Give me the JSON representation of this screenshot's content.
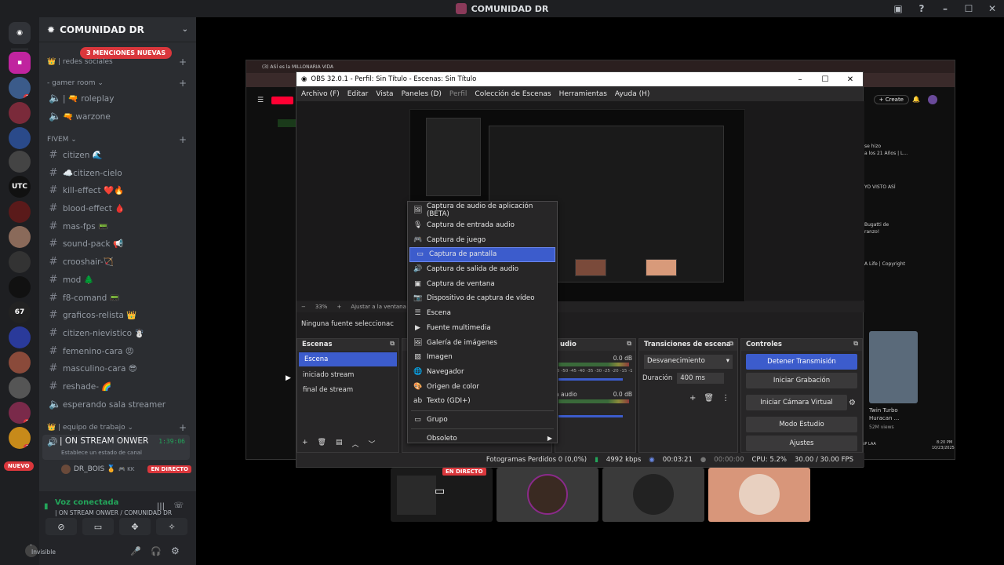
{
  "window": {
    "title": "COMUNIDAD DR"
  },
  "server": {
    "name": "COMUNIDAD DR",
    "mentions_badge": "3 MENCIONES NUEVAS",
    "new_badge": "NUEVO"
  },
  "rail": {
    "badges": [
      "3",
      "3",
      "2",
      "3"
    ],
    "labels": [
      "UTC",
      "67"
    ]
  },
  "sidebar": {
    "items": [
      {
        "type": "category",
        "label": "| redes sociales",
        "prefix": "👑"
      },
      {
        "type": "category",
        "label": "- gamer room ⌄"
      },
      {
        "type": "voice",
        "label": "| 🔫 roleplay"
      },
      {
        "type": "voice",
        "label": "🔫 warzone"
      },
      {
        "type": "category",
        "label": "FIVEM ⌄"
      },
      {
        "type": "text",
        "label": "citizen 🌊"
      },
      {
        "type": "text",
        "label": "☁️citizen-cielo"
      },
      {
        "type": "text",
        "label": "kill-effect ❤️🔥"
      },
      {
        "type": "text",
        "label": "blood-effect 🩸"
      },
      {
        "type": "text",
        "label": "mas-fps 📟"
      },
      {
        "type": "text",
        "label": "sound-pack 📢"
      },
      {
        "type": "text",
        "label": "crooshair-🏹"
      },
      {
        "type": "text",
        "label": "mod 🌲"
      },
      {
        "type": "text",
        "label": "f8-comand 📟"
      },
      {
        "type": "text",
        "label": "graficos-relista 👑"
      },
      {
        "type": "text",
        "label": "citizen-nievistico ☃️"
      },
      {
        "type": "text",
        "label": "femenino-cara 😡"
      },
      {
        "type": "text",
        "label": "masculino-cara 😎"
      },
      {
        "type": "text",
        "label": "reshade- 🌈"
      },
      {
        "type": "voice",
        "label": "esperando sala streamer"
      },
      {
        "type": "category",
        "label": "| equipo de trabajo ⌄",
        "prefix": "👑"
      }
    ],
    "active_voice": {
      "label": "| ON STREAM ONWER",
      "status": "Establece un estado de canal",
      "timer": "1:39:06",
      "member": "DR_BOIS 🏅",
      "member_extra": "🎮 KK",
      "live_badge": "EN DIRECTO"
    }
  },
  "voice_panel": {
    "status": "Voz conectada",
    "channel": "| ON STREAM ONWER / COMUNIDAD DR"
  },
  "user_panel": {
    "name": ".",
    "status": "Invisible"
  },
  "obs": {
    "title": "OBS 32.0.1 - Perfil: Sin Título - Escenas: Sin Título",
    "menu": [
      "Archivo (F)",
      "Editar",
      "Vista",
      "Paneles (D)",
      "Perfil",
      "Colección de Escenas",
      "Herramientas",
      "Ayuda (H)"
    ],
    "zoom": "33%",
    "fit": "Ajustar a la ventana",
    "no_source": "Ninguna fuente seleccionac",
    "docks": {
      "scenes": {
        "title": "Escenas",
        "items": [
          "Escena",
          "iniciado stream",
          "final de stream"
        ]
      },
      "audio": {
        "title": "udio",
        "db1": "0.0 dB",
        "db2": "0.0 dB",
        "mic": "a audio",
        "ticks": "5 -50 -45 -40 -35 -30 -25 -20 -15 -10 -5 0"
      },
      "transitions": {
        "title": "Transiciones de escena",
        "selected": "Desvanecimiento",
        "duration_label": "Duración",
        "duration_value": "400 ms"
      },
      "controls": {
        "title": "Controles",
        "buttons": [
          "Detener Transmisión",
          "Iniciar Grabación",
          "Iniciar Cámara Virtual",
          "Modo Estudio",
          "Ajustes"
        ]
      }
    },
    "status": {
      "dropped": "Fotogramas Perdidos 0 (0,0%)",
      "bitrate": "4992 kbps",
      "stream_time": "00:03:21",
      "rec_time": "00:00:00",
      "cpu": "CPU: 5.2%",
      "fps": "30.00 / 30.00 FPS"
    },
    "context_menu": {
      "items": [
        {
          "icon": "🖼",
          "label": "Captura de audio de aplicación (BETA)"
        },
        {
          "icon": "🎙",
          "label": "Captura de entrada audio"
        },
        {
          "icon": "🎮",
          "label": "Captura de juego"
        },
        {
          "icon": "▭",
          "label": "Captura de pantalla",
          "highlighted": true
        },
        {
          "icon": "🔊",
          "label": "Captura de salida de audio"
        },
        {
          "icon": "▣",
          "label": "Captura de ventana"
        },
        {
          "icon": "📷",
          "label": "Dispositivo de captura de vídeo"
        },
        {
          "icon": "☰",
          "label": "Escena"
        },
        {
          "icon": "▶",
          "label": "Fuente multimedia"
        },
        {
          "icon": "🖼",
          "label": "Galería de imágenes"
        },
        {
          "icon": "▨",
          "label": "Imagen"
        },
        {
          "icon": "🌐",
          "label": "Navegador"
        },
        {
          "icon": "🎨",
          "label": "Origen de color"
        },
        {
          "icon": "ab",
          "label": "Texto (GDI+)"
        }
      ],
      "group": "Grupo",
      "obsolete": "Obsoleto"
    }
  },
  "browser": {
    "tab": "(3) ASÍ es la MILLONARIA VIDA",
    "create_label": "Create",
    "side_items": [
      "Twin Turbo",
      "Huracan ...",
      "52M views"
    ],
    "yt_snippets": [
      "se hizo",
      "a los 21 Años | L...",
      "YO VISTO ASÍ",
      "Bugatti de",
      "ranzo!",
      "A Life | Copyright"
    ],
    "clock": "8:20 PM",
    "date": "10/23/2025",
    "lang": "ESP LAA"
  },
  "tiles": {
    "live_badge": "EN DIRECTO"
  },
  "colors": {
    "accent": "#3c5ccc",
    "live": "#da373c",
    "voice_green": "#23a55a"
  }
}
